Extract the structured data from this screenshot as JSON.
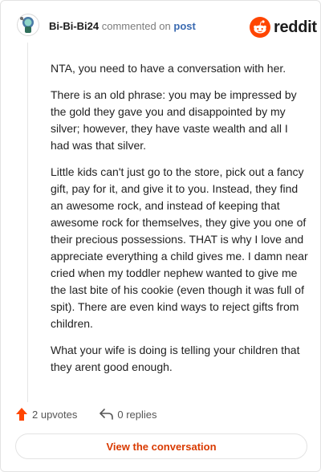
{
  "comment": {
    "username": "Bi-Bi-Bi24",
    "action_text": "commented on",
    "post_link": "post",
    "brand": "reddit",
    "paragraphs": [
      "NTA, you need to have a conversation with her.",
      "There is an old phrase: you may be impressed by the gold they gave you and disappointed by my silver; however, they have vaste wealth and all I had was that silver.",
      "Little kids can't just go to the store, pick out a fancy gift, pay for it, and give it to you. Instead, they find an awesome rock, and instead of keeping that awesome rock for themselves, they give you one of their precious possessions. THAT is why I love and appreciate everything a child gives me. I damn near cried when my toddler nephew wanted to give me the last bite of his cookie (even though it was full of spit). There are even kind ways to reject gifts from children.",
      "What your wife is doing is telling your children that they arent good enough."
    ],
    "upvotes": "2 upvotes",
    "replies": "0 replies",
    "cta_label": "View the conversation"
  },
  "colors": {
    "brand_orange": "#ff4500",
    "link_blue": "#3a6ab1",
    "cta_text": "#d93a00"
  },
  "icons": [
    "avatar",
    "reddit-snoo-icon",
    "upvote-arrow-icon",
    "reply-arrow-icon"
  ]
}
